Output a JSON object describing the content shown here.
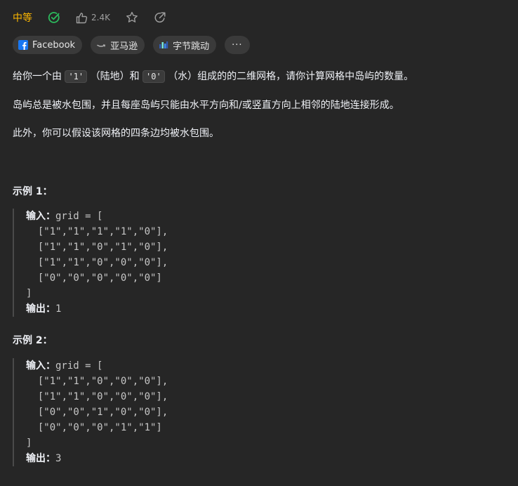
{
  "header": {
    "difficulty": "中等",
    "likes": "2.4K"
  },
  "tags": [
    {
      "label": "Facebook"
    },
    {
      "label": "亚马逊"
    },
    {
      "label": "字节跳动"
    },
    {
      "label": "···"
    }
  ],
  "description": {
    "p1_a": "给你一个由",
    "p1_code1": "'1'",
    "p1_b": "（陆地）和",
    "p1_code2": "'0'",
    "p1_c": "（水）组成的的二维网格，请你计算网格中岛屿的数量。",
    "p2": "岛屿总是被水包围，并且每座岛屿只能由水平方向和/或竖直方向上相邻的陆地连接形成。",
    "p3": "此外，你可以假设该网格的四条边均被水包围。"
  },
  "examples": [
    {
      "title": "示例 1：",
      "input_label": "输入：",
      "input_head": "grid = [",
      "rows": [
        "  [\"1\",\"1\",\"1\",\"1\",\"0\"],",
        "  [\"1\",\"1\",\"0\",\"1\",\"0\"],",
        "  [\"1\",\"1\",\"0\",\"0\",\"0\"],",
        "  [\"0\",\"0\",\"0\",\"0\",\"0\"]"
      ],
      "close": "]",
      "output_label": "输出：",
      "output": "1"
    },
    {
      "title": "示例 2：",
      "input_label": "输入：",
      "input_head": "grid = [",
      "rows": [
        "  [\"1\",\"1\",\"0\",\"0\",\"0\"],",
        "  [\"1\",\"1\",\"0\",\"0\",\"0\"],",
        "  [\"0\",\"0\",\"1\",\"0\",\"0\"],",
        "  [\"0\",\"0\",\"0\",\"1\",\"1\"]"
      ],
      "close": "]",
      "output_label": "输出：",
      "output": "3"
    }
  ],
  "colors": {
    "background": "#262626",
    "difficulty": "#ffb800",
    "solved": "#2cbb5d",
    "text": "#eff1f6",
    "muted": "#9e9e9e"
  },
  "icons": [
    "solved-check-icon",
    "thumbs-up-icon",
    "star-icon",
    "share-icon",
    "facebook-icon",
    "amazon-icon",
    "bytedance-icon"
  ]
}
